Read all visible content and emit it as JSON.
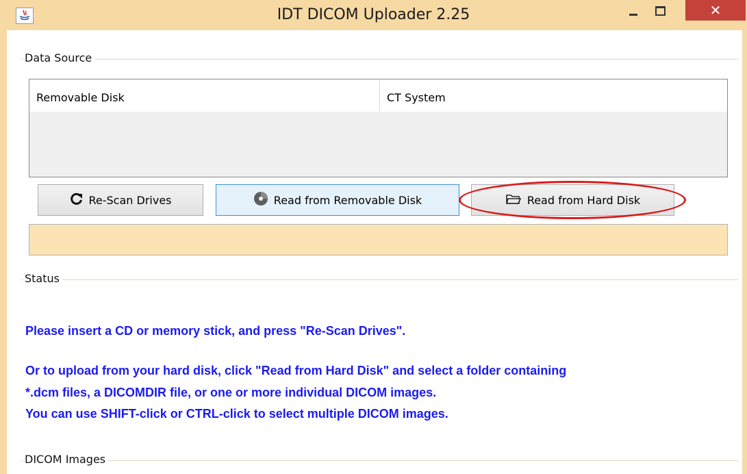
{
  "window": {
    "title": "IDT DICOM Uploader 2.25",
    "close_glyph": "✕",
    "title_bar_color": "#f6d9a3",
    "close_button_color": "#c4423a"
  },
  "data_source": {
    "label": "Data Source",
    "table": {
      "columns": [
        "Removable Disk",
        "CT System"
      ]
    },
    "buttons": {
      "rescan": {
        "label": "Re-Scan Drives",
        "icon": "refresh-icon"
      },
      "read_removable": {
        "label": "Read from Removable Disk",
        "icon": "disc-icon"
      },
      "read_hard": {
        "label": "Read from Hard Disk",
        "icon": "folder-icon"
      }
    },
    "progress_color": "#fbe3b4"
  },
  "status": {
    "label": "Status",
    "messages": [
      "Please insert a CD or memory stick, and press \"Re-Scan Drives\".",
      "Or to upload from your hard disk, click \"Read from Hard Disk\" and select a folder containing",
      "*.dcm files, a DICOMDIR file, or one or more individual DICOM images.",
      "You can use SHIFT-click or CTRL-click to select multiple DICOM images."
    ],
    "text_color": "#1b1bf2"
  },
  "dicom_images": {
    "label": "DICOM Images"
  },
  "annotation": {
    "highlight_color": "#d81c1c"
  }
}
